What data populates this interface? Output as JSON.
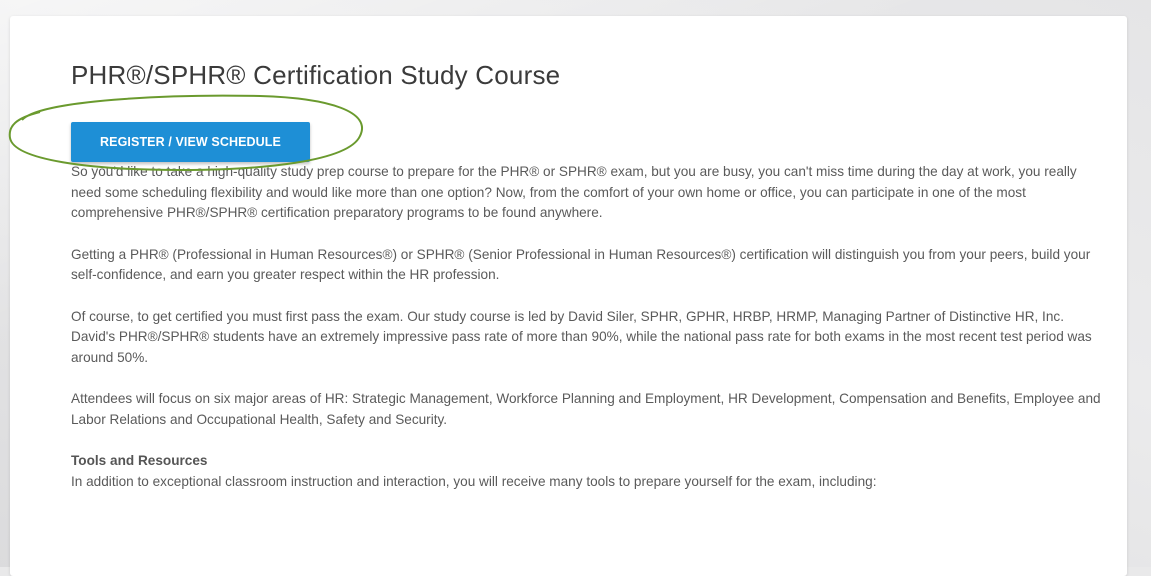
{
  "page": {
    "title": "PHR®/SPHR® Certification Study Course"
  },
  "register_button": {
    "label": "REGISTER / VIEW SCHEDULE"
  },
  "highlight": {
    "color": "#6a9a2e"
  },
  "paragraphs": [
    "So you'd like to take a high-quality study prep course to prepare for the PHR® or SPHR® exam, but you are busy, you can't miss time during the day at work, you really need some scheduling flexibility and would like more than one option? Now, from the comfort of your own home or office, you can participate in one of the most comprehensive PHR®/SPHR® certification preparatory programs to be found anywhere.",
    "Getting a PHR® (Professional in Human Resources®) or SPHR® (Senior Professional in Human Resources®) certification will distinguish you from your peers, build your self-confidence, and earn you greater respect within the HR profession.",
    "Of course, to get certified you must first pass the exam. Our study course is led by David Siler, SPHR, GPHR, HRBP, HRMP, Managing Partner of Distinctive HR, Inc. David's PHR®/SPHR® students have an extremely impressive pass rate of more than 90%, while the national pass rate for both exams in the most recent test period was around 50%.",
    "Attendees will focus on six major areas of HR: Strategic Management, Workforce Planning and Employment, HR Development, Compensation and Benefits, Employee and Labor Relations and Occupational Health, Safety and Security."
  ],
  "tools_section": {
    "heading": "Tools and Resources",
    "intro": "In addition to exceptional classroom instruction and interaction, you will receive many tools to prepare yourself for the exam, including:"
  }
}
